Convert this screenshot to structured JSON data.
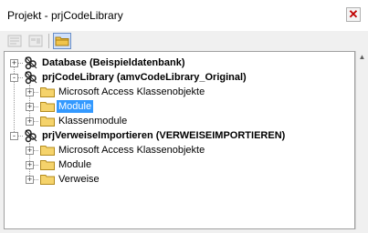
{
  "window": {
    "title": "Projekt - prjCodeLibrary",
    "close_label": "✕"
  },
  "toolbar": {
    "buttons": [
      {
        "icon": "view-code-icon",
        "enabled": false
      },
      {
        "icon": "view-object-icon",
        "enabled": false
      },
      {
        "icon": "toggle-folders-icon",
        "enabled": true,
        "pressed": true
      }
    ]
  },
  "tree": {
    "nodes": [
      {
        "label": "Database (Beispieldatenbank)",
        "level": 0,
        "bold": true,
        "icon": "vba-project-icon",
        "expander": "+"
      },
      {
        "label": "prjCodeLibrary (amvCodeLibrary_Original)",
        "level": 0,
        "bold": true,
        "icon": "vba-project-icon",
        "expander": "-"
      },
      {
        "label": "Microsoft Access Klassenobjekte",
        "level": 1,
        "icon": "folder-icon",
        "expander": "+"
      },
      {
        "label": "Module",
        "level": 1,
        "icon": "folder-icon",
        "expander": "+",
        "selected": true
      },
      {
        "label": "Klassenmodule",
        "level": 1,
        "icon": "folder-icon",
        "expander": "+"
      },
      {
        "label": "prjVerweiseImportieren (VERWEISEIMPORTIEREN)",
        "level": 0,
        "bold": true,
        "icon": "vba-project-icon",
        "expander": "-"
      },
      {
        "label": "Microsoft Access Klassenobjekte",
        "level": 1,
        "icon": "folder-icon",
        "expander": "+"
      },
      {
        "label": "Module",
        "level": 1,
        "icon": "folder-icon",
        "expander": "+"
      },
      {
        "label": "Verweise",
        "level": 1,
        "icon": "folder-icon",
        "expander": "+"
      }
    ]
  },
  "colors": {
    "selection": "#3399ff",
    "folder": "#f5d36b",
    "close": "#c00000"
  }
}
